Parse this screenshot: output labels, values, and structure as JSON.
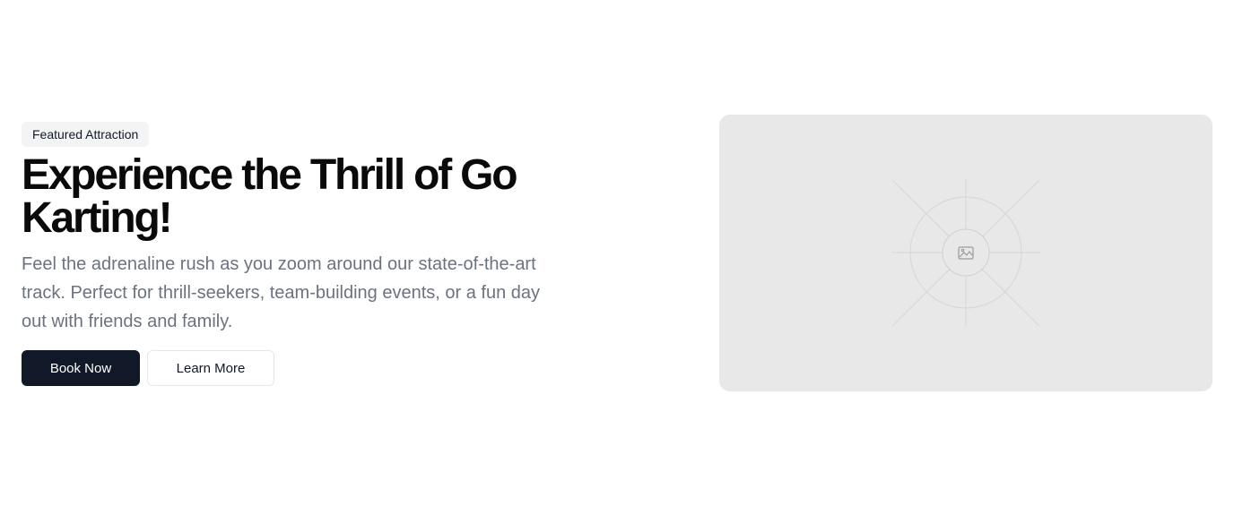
{
  "hero": {
    "badge": "Featured Attraction",
    "title": "Experience the Thrill of Go Karting!",
    "description": "Feel the adrenaline rush as you zoom around our state-of-the-art track. Perfect for thrill-seekers, team-building events, or a fun day out with friends and family.",
    "primary_button": "Book Now",
    "secondary_button": "Learn More"
  },
  "media": {
    "icon": "image-placeholder-icon"
  },
  "colors": {
    "primary": "#111827",
    "muted_text": "#6b7280",
    "badge_bg": "#f3f4f6",
    "placeholder_bg": "#e8e8e8"
  }
}
